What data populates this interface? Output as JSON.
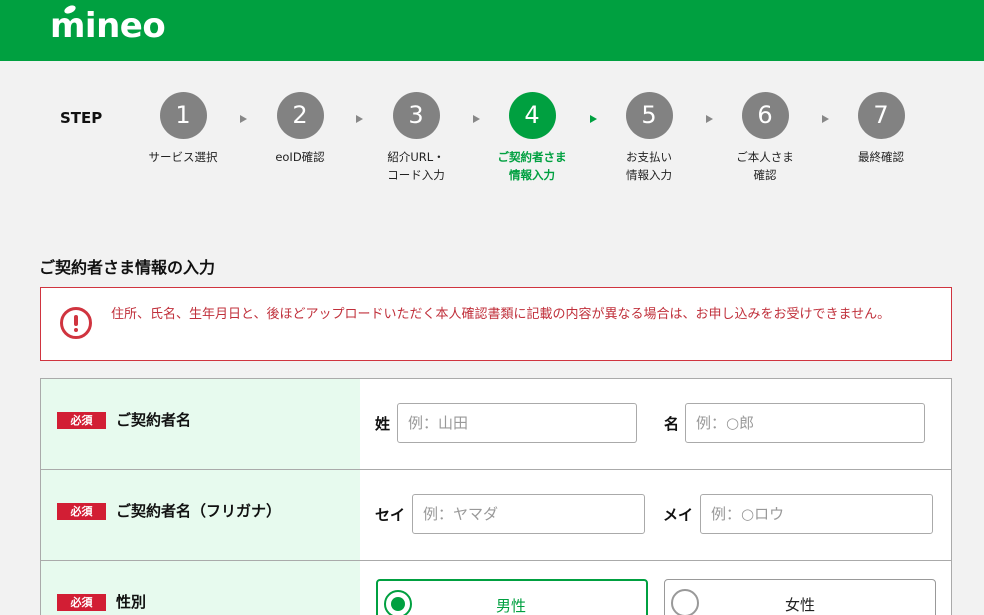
{
  "header": {
    "logo_text": "mineo",
    "brand_color": "#00a040"
  },
  "steps": {
    "label": "STEP",
    "items": [
      {
        "num": "1",
        "label": "サービス選択",
        "state": "done"
      },
      {
        "num": "2",
        "label": "eoID確認",
        "state": "done"
      },
      {
        "num": "3",
        "label": "紹介URL・\nコード入力",
        "state": "done"
      },
      {
        "num": "4",
        "label": "ご契約者さま\n情報入力",
        "state": "active"
      },
      {
        "num": "5",
        "label": "お支払い\n情報入力",
        "state": "todo"
      },
      {
        "num": "6",
        "label": "ご本人さま\n確認",
        "state": "todo"
      },
      {
        "num": "7",
        "label": "最終確認",
        "state": "todo"
      }
    ]
  },
  "section_title": "ご契約者さま情報の入力",
  "alert": {
    "icon": "exclamation-circle-icon",
    "text": "住所、氏名、生年月日と、後ほどアップロードいただく本人確認書類に記載の内容が異なる場合は、お申し込みをお受けできません。"
  },
  "form": {
    "required_badge": "必須",
    "name_row": {
      "label": "ご契約者名",
      "last": {
        "label": "姓",
        "placeholder": "例：山田"
      },
      "first": {
        "label": "名",
        "placeholder": "例：○郎"
      }
    },
    "kana_row": {
      "label": "ご契約者名（フリガナ）",
      "last": {
        "label": "セイ",
        "placeholder": "例：ヤマダ"
      },
      "first": {
        "label": "メイ",
        "placeholder": "例：○ロウ"
      }
    },
    "gender_row": {
      "label": "性別",
      "options": [
        {
          "label": "男性",
          "selected": true
        },
        {
          "label": "女性",
          "selected": false
        }
      ]
    }
  }
}
